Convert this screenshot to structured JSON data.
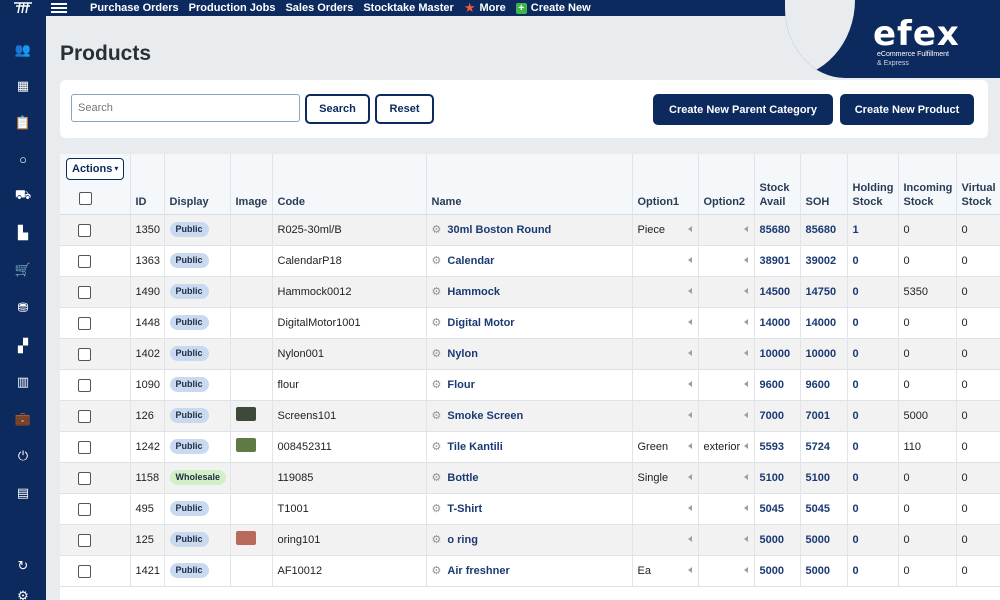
{
  "topbar": {
    "nav": [
      {
        "label": "Purchase Orders"
      },
      {
        "label": "Production Jobs"
      },
      {
        "label": "Sales Orders"
      },
      {
        "label": "Stocktake Master"
      },
      {
        "label": "More",
        "icon": "star-icon"
      },
      {
        "label": "Create New",
        "icon": "plus-icon"
      }
    ]
  },
  "brand": {
    "name": "efex",
    "tagline": "eCommerce Fulfillment",
    "tagline2": "& Express"
  },
  "sidebar": {
    "items": [
      {
        "icon": "users-icon",
        "glyph": "👥"
      },
      {
        "icon": "box-icon",
        "glyph": "▦"
      },
      {
        "icon": "clipboard-icon",
        "glyph": "📋"
      },
      {
        "icon": "circle-icon",
        "glyph": "○"
      },
      {
        "icon": "truck-icon",
        "glyph": "⛟"
      },
      {
        "icon": "factory-icon",
        "glyph": "▙"
      },
      {
        "icon": "cart-icon",
        "glyph": "🛒"
      },
      {
        "icon": "coins-icon",
        "glyph": "⛃"
      },
      {
        "icon": "boxes-icon",
        "glyph": "▞"
      },
      {
        "icon": "bar-chart-icon",
        "glyph": "▥"
      },
      {
        "icon": "briefcase-icon",
        "glyph": "💼"
      },
      {
        "icon": "plug-icon",
        "glyph": "⏻"
      },
      {
        "icon": "store-icon",
        "glyph": "▤"
      },
      {
        "icon": "sync-icon",
        "glyph": "↻"
      },
      {
        "icon": "gear-icon",
        "glyph": "⚙"
      }
    ]
  },
  "page": {
    "title": "Products"
  },
  "search": {
    "placeholder": "Search",
    "search_label": "Search",
    "reset_label": "Reset",
    "create_parent_label": "Create New Parent Category",
    "create_product_label": "Create New Product"
  },
  "table": {
    "actions_label": "Actions",
    "headers": {
      "id": "ID",
      "display": "Display",
      "image": "Image",
      "code": "Code",
      "name": "Name",
      "option1": "Option1",
      "option2": "Option2",
      "stock_avail_1": "Stock",
      "stock_avail_2": "Avail",
      "soh": "SOH",
      "holding_1": "Holding",
      "holding_2": "Stock",
      "incoming_1": "Incoming",
      "incoming_2": "Stock",
      "virtual_1": "Virtual",
      "virtual_2": "Stock"
    },
    "rows": [
      {
        "id": "1350",
        "display": "Public",
        "display_color": "#c9d9ef",
        "image": "",
        "code": "R025-30ml/B",
        "name": "30ml Boston Round",
        "option1": "Piece",
        "option2": "",
        "stock_avail": "85680",
        "soh": "85680",
        "holding": "1",
        "incoming": "0",
        "virtual": "0"
      },
      {
        "id": "1363",
        "display": "Public",
        "display_color": "#c9d9ef",
        "image": "",
        "code": "CalendarP18",
        "name": "Calendar",
        "option1": "",
        "option2": "",
        "stock_avail": "38901",
        "soh": "39002",
        "holding": "0",
        "incoming": "0",
        "virtual": "0"
      },
      {
        "id": "1490",
        "display": "Public",
        "display_color": "#c9d9ef",
        "image": "",
        "code": "Hammock0012",
        "name": "Hammock",
        "option1": "",
        "option2": "",
        "stock_avail": "14500",
        "soh": "14750",
        "holding": "0",
        "incoming": "5350",
        "virtual": "0"
      },
      {
        "id": "1448",
        "display": "Public",
        "display_color": "#c9d9ef",
        "image": "",
        "code": "DigitalMotor1001",
        "name": "Digital Motor",
        "option1": "",
        "option2": "",
        "stock_avail": "14000",
        "soh": "14000",
        "holding": "0",
        "incoming": "0",
        "virtual": "0"
      },
      {
        "id": "1402",
        "display": "Public",
        "display_color": "#c9d9ef",
        "image": "",
        "code": "Nylon001",
        "name": "Nylon",
        "option1": "",
        "option2": "",
        "stock_avail": "10000",
        "soh": "10000",
        "holding": "0",
        "incoming": "0",
        "virtual": "0"
      },
      {
        "id": "1090",
        "display": "Public",
        "display_color": "#c9d9ef",
        "image": "",
        "code": "flour",
        "name": "Flour",
        "option1": "",
        "option2": "",
        "stock_avail": "9600",
        "soh": "9600",
        "holding": "0",
        "incoming": "0",
        "virtual": "0"
      },
      {
        "id": "126",
        "display": "Public",
        "display_color": "#c9d9ef",
        "image": "screen-thumbnail",
        "code": "Screens101",
        "name": "Smoke Screen",
        "option1": "",
        "option2": "",
        "stock_avail": "7000",
        "soh": "7001",
        "holding": "0",
        "incoming": "5000",
        "virtual": "0"
      },
      {
        "id": "1242",
        "display": "Public",
        "display_color": "#c9d9ef",
        "image": "tile-thumbnail",
        "code": "008452311",
        "name": "Tile Kantili",
        "option1": "Green",
        "option2": "exterior",
        "stock_avail": "5593",
        "soh": "5724",
        "holding": "0",
        "incoming": "110",
        "virtual": "0"
      },
      {
        "id": "1158",
        "display": "Wholesale",
        "display_color": "#d3efc7",
        "image": "",
        "code": "119085",
        "name": "Bottle",
        "option1": "Single",
        "option2": "",
        "stock_avail": "5100",
        "soh": "5100",
        "holding": "0",
        "incoming": "0",
        "virtual": "0"
      },
      {
        "id": "495",
        "display": "Public",
        "display_color": "#c9d9ef",
        "image": "",
        "code": "T1001",
        "name": "T-Shirt",
        "option1": "",
        "option2": "",
        "stock_avail": "5045",
        "soh": "5045",
        "holding": "0",
        "incoming": "0",
        "virtual": "0"
      },
      {
        "id": "125",
        "display": "Public",
        "display_color": "#c9d9ef",
        "image": "oring-thumbnail",
        "code": "oring101",
        "name": "o ring",
        "option1": "",
        "option2": "",
        "stock_avail": "5000",
        "soh": "5000",
        "holding": "0",
        "incoming": "0",
        "virtual": "0"
      },
      {
        "id": "1421",
        "display": "Public",
        "display_color": "#c9d9ef",
        "image": "",
        "code": "AF10012",
        "name": "Air freshner",
        "option1": "Ea",
        "option2": "",
        "stock_avail": "5000",
        "soh": "5000",
        "holding": "0",
        "incoming": "0",
        "virtual": "0"
      }
    ]
  }
}
